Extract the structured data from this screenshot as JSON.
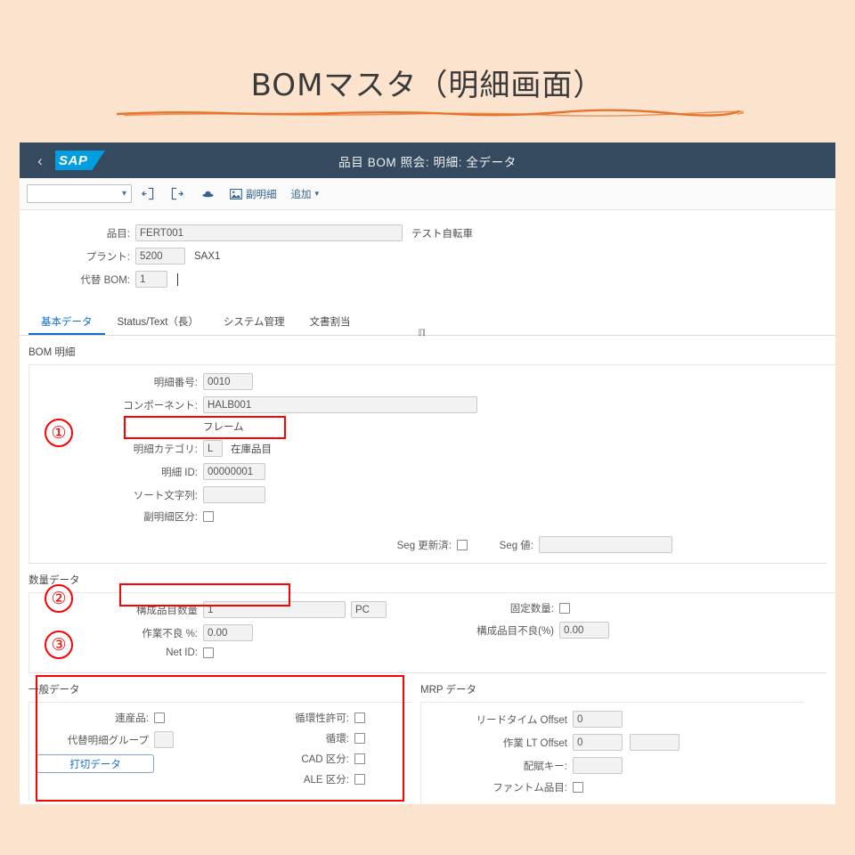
{
  "slide": {
    "title": "BOMマスタ（明細画面）"
  },
  "shell": {
    "back_icon": "back-chevron-icon",
    "logo_text": "SAP",
    "title": "品目 BOM 照会: 明細: 全データ"
  },
  "toolbar": {
    "variant_value": "",
    "variant_caret": "⌄",
    "icons": [
      {
        "name": "previous-item-icon"
      },
      {
        "name": "next-item-icon"
      },
      {
        "name": "display-variant-icon"
      }
    ],
    "sub_item_label": "副明細",
    "add_label": "追加",
    "add_caret": "⌄"
  },
  "header_form": {
    "material_label": "品目:",
    "material_value": "FERT001",
    "material_desc": "テスト自転車",
    "plant_label": "プラント:",
    "plant_value": "5200",
    "plant_desc": "SAX1",
    "alt_bom_label": "代替 BOM:",
    "alt_bom_value": "1"
  },
  "tabs": [
    {
      "label": "基本データ",
      "active": true
    },
    {
      "label": "Status/Text（長）",
      "active": false
    },
    {
      "label": "システム管理",
      "active": false
    },
    {
      "label": "文書割当",
      "active": false
    }
  ],
  "bom_item": {
    "section_title": "BOM 明細",
    "item_no_label": "明細番号:",
    "item_no_value": "0010",
    "component_label": "コンポーネント:",
    "component_value": "HALB001",
    "component_desc": "フレーム",
    "item_category_label": "明細カテゴリ:",
    "item_category_value": "L",
    "item_category_desc": "在庫品目",
    "item_id_label": "明細 ID:",
    "item_id_value": "00000001",
    "sort_string_label": "ソート文字列:",
    "sort_string_value": "",
    "sub_item_flag_label": "副明細区分:",
    "seg_updated_label": "Seg 更新済:",
    "seg_value_label": "Seg 値:",
    "seg_value": ""
  },
  "quantity_data": {
    "section_title": "数量データ",
    "component_qty_label": "構成品目数量",
    "component_qty_value": "1",
    "component_qty_uom": "PC",
    "fixed_qty_label": "固定数量:",
    "op_scrap_label": "作業不良 %:",
    "op_scrap_value": "0.00",
    "comp_scrap_label": "構成品目不良(%)",
    "comp_scrap_value": "0.00",
    "net_id_label": "Net ID:"
  },
  "general_data": {
    "section_title": "一般データ",
    "coproduct_label": "連産品:",
    "alt_item_group_label": "代替明細グループ",
    "alt_item_group_value": "",
    "cutoff_button_label": "打切データ",
    "recursive_allowed_label": "循環性許可:",
    "recursive_label": "循環:",
    "cad_indicator_label": "CAD 区分:",
    "ale_indicator_label": "ALE 区分:"
  },
  "mrp_data": {
    "section_title": "MRP データ",
    "lead_time_offset_label": "リードタイム Offset",
    "lead_time_offset_value": "0",
    "op_lt_offset_label": "作業 LT Offset",
    "op_lt_offset_value": "0",
    "op_lt_offset_value2": "",
    "distribution_key_label": "配賦キー:",
    "distribution_key_value": "",
    "phantom_item_label": "ファントム品目:"
  },
  "annotations": [
    {
      "number": "①"
    },
    {
      "number": "②"
    },
    {
      "number": "③"
    }
  ],
  "colors": {
    "background": "#fbe3ce",
    "shell_header": "#354a5f",
    "sap_blue": "#009de0",
    "accent_link": "#0a6ed1",
    "annotation_red": "#ff0000",
    "underline_orange": "#e8742c"
  }
}
